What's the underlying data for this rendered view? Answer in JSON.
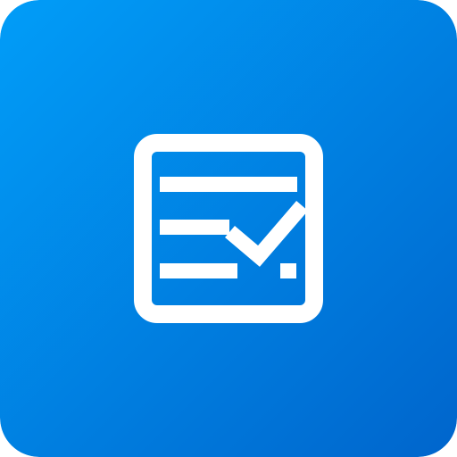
{
  "icon": {
    "name": "checklist-form-icon",
    "symbol": "document-with-lines-and-checkmark",
    "colors": {
      "gradient_start": "#019df8",
      "gradient_end": "#0065cc",
      "glyph": "#ffffff"
    }
  }
}
